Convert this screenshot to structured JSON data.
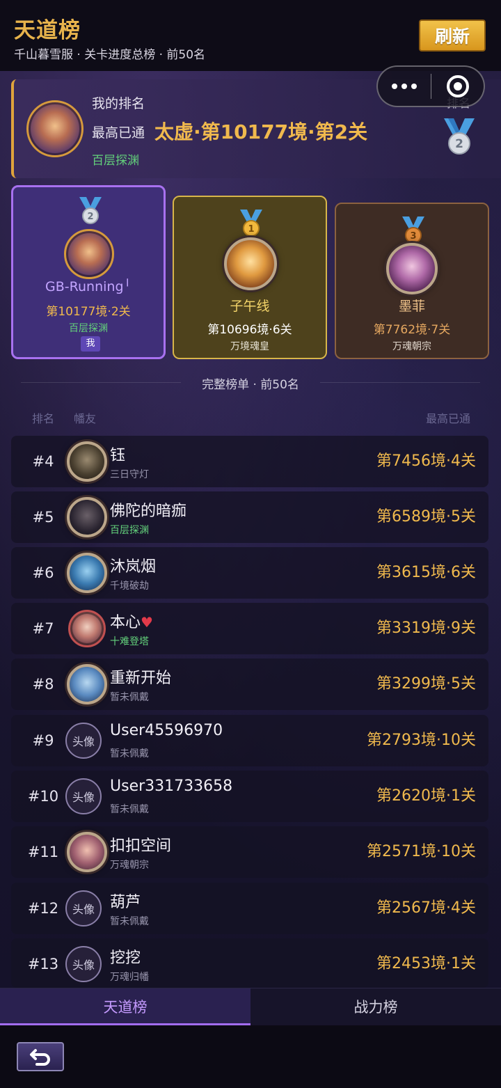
{
  "header": {
    "title": "天道榜",
    "subtitle": "千山暮雪服 · 关卡进度总榜 · 前50名",
    "refresh_label": "刷新"
  },
  "my_rank": {
    "label": "我的排名",
    "best_prefix": "最高已通",
    "best_value": "太虚·第10177境·第2关",
    "title": "百层探渊",
    "rank_label": "排名",
    "rank": "2"
  },
  "podium": [
    {
      "rank": "2",
      "name": "GB-Running╵",
      "stage": "第10177境·2关",
      "title": "百层探渊",
      "tag": "我"
    },
    {
      "rank": "1",
      "name": "子午线",
      "stage": "第10696境·6关",
      "title": "万境魂皇"
    },
    {
      "rank": "3",
      "name": "墨菲",
      "stage": "第7762境·7关",
      "title": "万魂朝宗"
    }
  ],
  "list": {
    "section_title": "完整榜单 · 前50名",
    "col_rank": "排名",
    "col_player": "幡友",
    "col_best": "最高已通",
    "rows": [
      {
        "rank": "#4",
        "name": "钰",
        "title": "三日守灯",
        "score": "第7456境·4关"
      },
      {
        "rank": "#5",
        "name": "佛陀的暗痂",
        "title": "百层探渊",
        "score": "第6589境·5关"
      },
      {
        "rank": "#6",
        "name": "沐岚烟",
        "title": "千境破劫",
        "score": "第3615境·6关"
      },
      {
        "rank": "#7",
        "name": "本心",
        "title": "十难登塔",
        "score": "第3319境·9关"
      },
      {
        "rank": "#8",
        "name": "重新开始",
        "title": "暂未佩戴",
        "score": "第3299境·5关"
      },
      {
        "rank": "#9",
        "name": "User45596970",
        "title": "暂未佩戴",
        "score": "第2793境·10关",
        "avatar_text": "头像"
      },
      {
        "rank": "#10",
        "name": "User331733658",
        "title": "暂未佩戴",
        "score": "第2620境·1关",
        "avatar_text": "头像"
      },
      {
        "rank": "#11",
        "name": "扣扣空间",
        "title": "万魂朝宗",
        "score": "第2571境·10关"
      },
      {
        "rank": "#12",
        "name": "葫芦",
        "title": "暂未佩戴",
        "score": "第2567境·4关",
        "avatar_text": "头像"
      },
      {
        "rank": "#13",
        "name": "挖挖",
        "title": "万魂归幡",
        "score": "第2453境·1关",
        "avatar_text": "头像"
      }
    ]
  },
  "tabs": {
    "active": "天道榜",
    "other": "战力榜"
  },
  "heart_symbol": "♥",
  "colors": {
    "gold": "#f0b94d",
    "green_title": "#63d17b",
    "purple_accent": "#a871f0"
  }
}
